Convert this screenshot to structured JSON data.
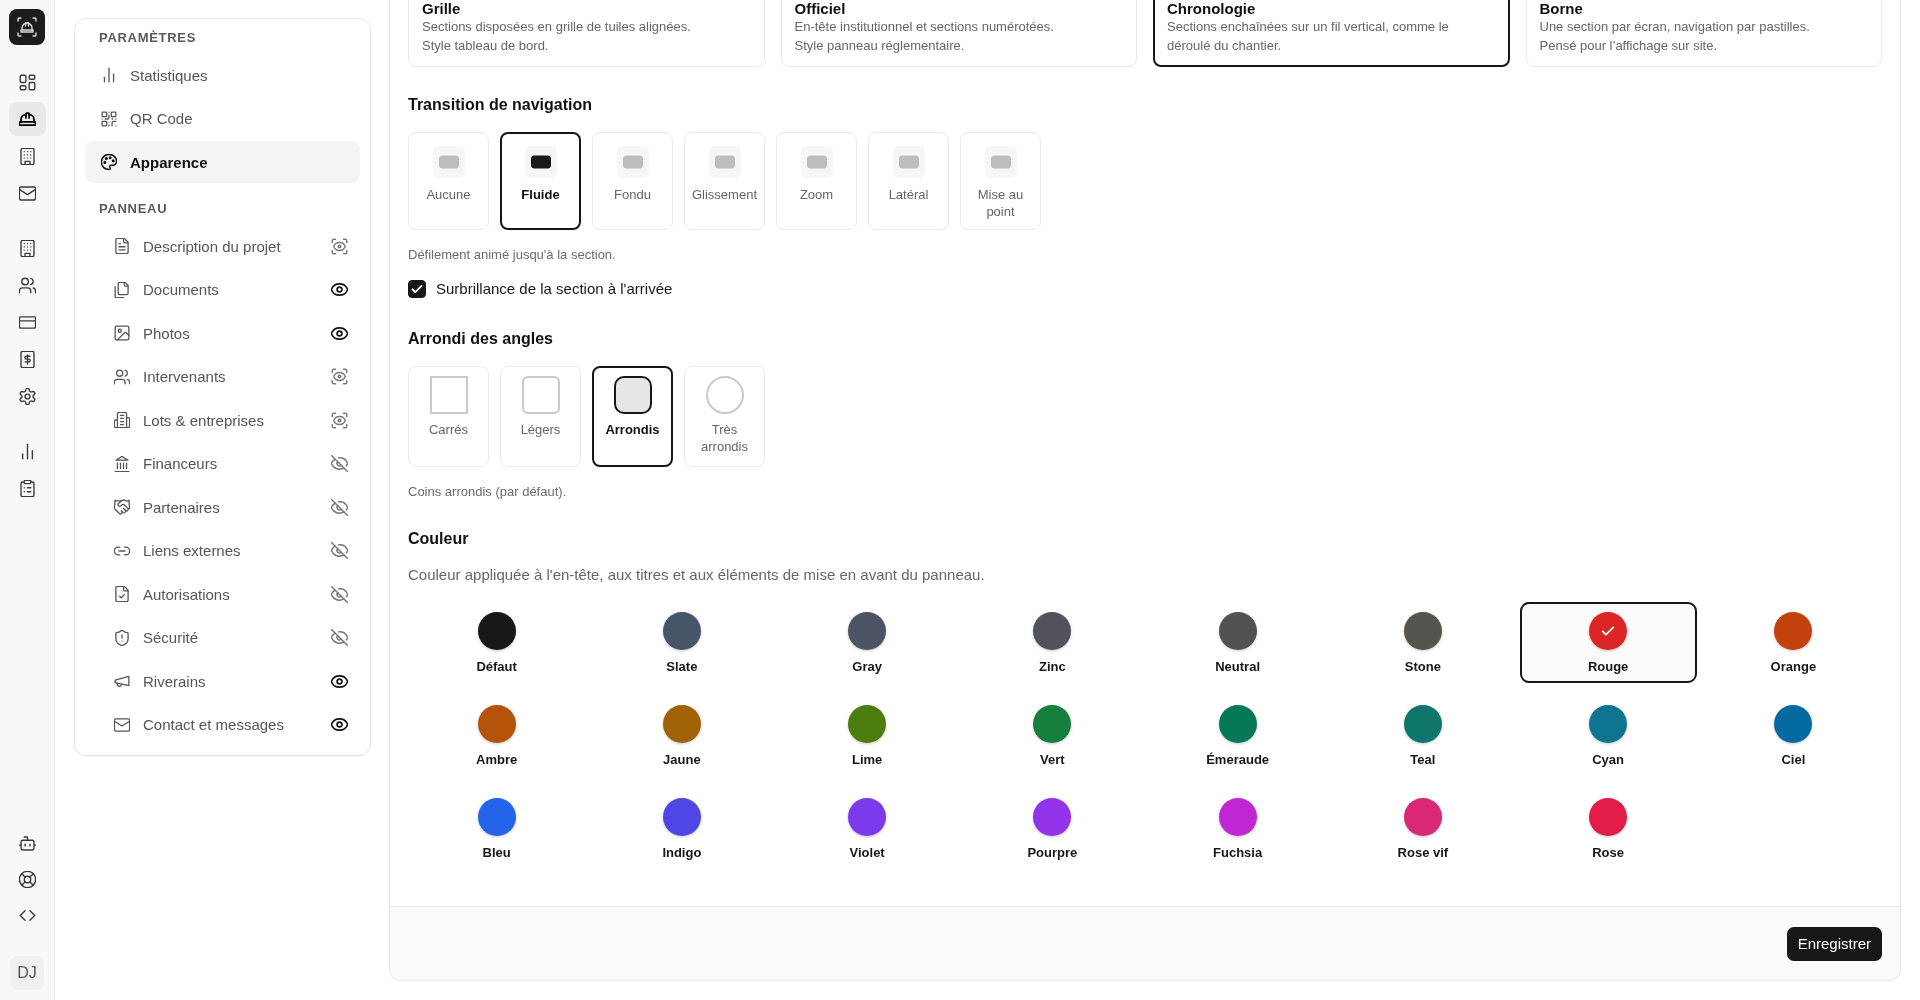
{
  "rail": {
    "groups": [
      [
        {
          "selected": false
        },
        {
          "selected": true
        },
        {
          "selected": false
        },
        {
          "selected": false
        }
      ],
      [
        {
          "selected": false
        },
        {
          "selected": false
        },
        {
          "selected": false
        },
        {
          "selected": false
        },
        {
          "selected": false
        }
      ],
      [
        {
          "selected": false
        },
        {
          "selected": false
        }
      ]
    ],
    "avatar": "DJ"
  },
  "sidebar": {
    "sections": [
      {
        "title": "PARAMÈTRES",
        "items": [
          {
            "label": "Statistiques",
            "selected": false
          },
          {
            "label": "QR Code",
            "selected": false
          },
          {
            "label": "Apparence",
            "selected": true
          }
        ]
      },
      {
        "title": "PANNEAU",
        "items": [
          {
            "label": "Description du projet",
            "selected": false,
            "visible": false,
            "auto": true
          },
          {
            "label": "Documents",
            "selected": false,
            "visible": true,
            "auto": false
          },
          {
            "label": "Photos",
            "selected": false,
            "visible": true,
            "auto": false
          },
          {
            "label": "Intervenants",
            "selected": false,
            "visible": false,
            "auto": true
          },
          {
            "label": "Lots & entreprises",
            "selected": false,
            "visible": false,
            "auto": true
          },
          {
            "label": "Financeurs",
            "selected": false,
            "visible": false,
            "auto": false
          },
          {
            "label": "Partenaires",
            "selected": false,
            "visible": false,
            "auto": false
          },
          {
            "label": "Liens externes",
            "selected": false,
            "visible": false,
            "auto": false
          },
          {
            "label": "Autorisations",
            "selected": false,
            "visible": false,
            "auto": false
          },
          {
            "label": "Sécurité",
            "selected": false,
            "visible": false,
            "auto": false
          },
          {
            "label": "Riverains",
            "selected": false,
            "visible": true,
            "auto": false
          },
          {
            "label": "Contact et messages",
            "selected": false,
            "visible": true,
            "auto": false
          }
        ]
      }
    ]
  },
  "layouts": [
    {
      "title": "Grille",
      "description": "Sections disposées en grille de tuiles alignées. Style tableau de bord.",
      "selected": false
    },
    {
      "title": "Officiel",
      "description": "En-tête institutionnel et sections numérotées. Style panneau réglementaire.",
      "selected": false
    },
    {
      "title": "Chronologie",
      "description": "Sections enchaînées sur un fil vertical, comme le déroulé du chantier.",
      "selected": true
    },
    {
      "title": "Borne",
      "description": "Une section par écran, navigation par pastilles. Pensé pour l’affichage sur site.",
      "selected": false
    }
  ],
  "transition": {
    "title": "Transition de navigation",
    "options": [
      {
        "label": "Aucune",
        "selected": false
      },
      {
        "label": "Fluide",
        "selected": true
      },
      {
        "label": "Fondu",
        "selected": false
      },
      {
        "label": "Glissement",
        "selected": false
      },
      {
        "label": "Zoom",
        "selected": false
      },
      {
        "label": "Latéral",
        "selected": false
      },
      {
        "label": "Mise au point",
        "selected": false
      }
    ],
    "hint": "Défilement animé jusqu'à la section.",
    "highlight": {
      "label": "Surbrillance de la section à l'arrivée",
      "checked": true
    }
  },
  "corners": {
    "title": "Arrondi des angles",
    "options": [
      {
        "label": "Carrés",
        "selected": false
      },
      {
        "label": "Légers",
        "selected": false
      },
      {
        "label": "Arrondis",
        "selected": true
      },
      {
        "label": "Très arrondis",
        "selected": false
      }
    ],
    "hint": "Coins arrondis (par défaut)."
  },
  "couleur": {
    "title": "Couleur",
    "description": "Couleur appliquée à l'en-tête, aux titres et aux éléments de mise en avant du panneau.",
    "swatches": [
      {
        "label": "Défaut",
        "color": "#171717",
        "selected": false
      },
      {
        "label": "Slate",
        "color": "#475569",
        "selected": false
      },
      {
        "label": "Gray",
        "color": "#4b5563",
        "selected": false
      },
      {
        "label": "Zinc",
        "color": "#52525b",
        "selected": false
      },
      {
        "label": "Neutral",
        "color": "#525252",
        "selected": false
      },
      {
        "label": "Stone",
        "color": "#57534e",
        "selected": false
      },
      {
        "label": "Rouge",
        "color": "#dc2626",
        "selected": true
      },
      {
        "label": "Orange",
        "color": "#c2410c",
        "selected": false
      },
      {
        "label": "Ambre",
        "color": "#b45309",
        "selected": false
      },
      {
        "label": "Jaune",
        "color": "#a16207",
        "selected": false
      },
      {
        "label": "Lime",
        "color": "#4d7c0f",
        "selected": false
      },
      {
        "label": "Vert",
        "color": "#15803d",
        "selected": false
      },
      {
        "label": "Émeraude",
        "color": "#047857",
        "selected": false
      },
      {
        "label": "Teal",
        "color": "#0f766e",
        "selected": false
      },
      {
        "label": "Cyan",
        "color": "#0e7490",
        "selected": false
      },
      {
        "label": "Ciel",
        "color": "#0369a1",
        "selected": false
      },
      {
        "label": "Bleu",
        "color": "#2563eb",
        "selected": false
      },
      {
        "label": "Indigo",
        "color": "#4f46e5",
        "selected": false
      },
      {
        "label": "Violet",
        "color": "#7c3aed",
        "selected": false
      },
      {
        "label": "Pourpre",
        "color": "#9333ea",
        "selected": false
      },
      {
        "label": "Fuchsia",
        "color": "#c026d3",
        "selected": false
      },
      {
        "label": "Rose vif",
        "color": "#db2777",
        "selected": false
      },
      {
        "label": "Rose",
        "color": "#e11d48",
        "selected": false
      }
    ]
  },
  "footer": {
    "save_button": "Enregistrer"
  }
}
